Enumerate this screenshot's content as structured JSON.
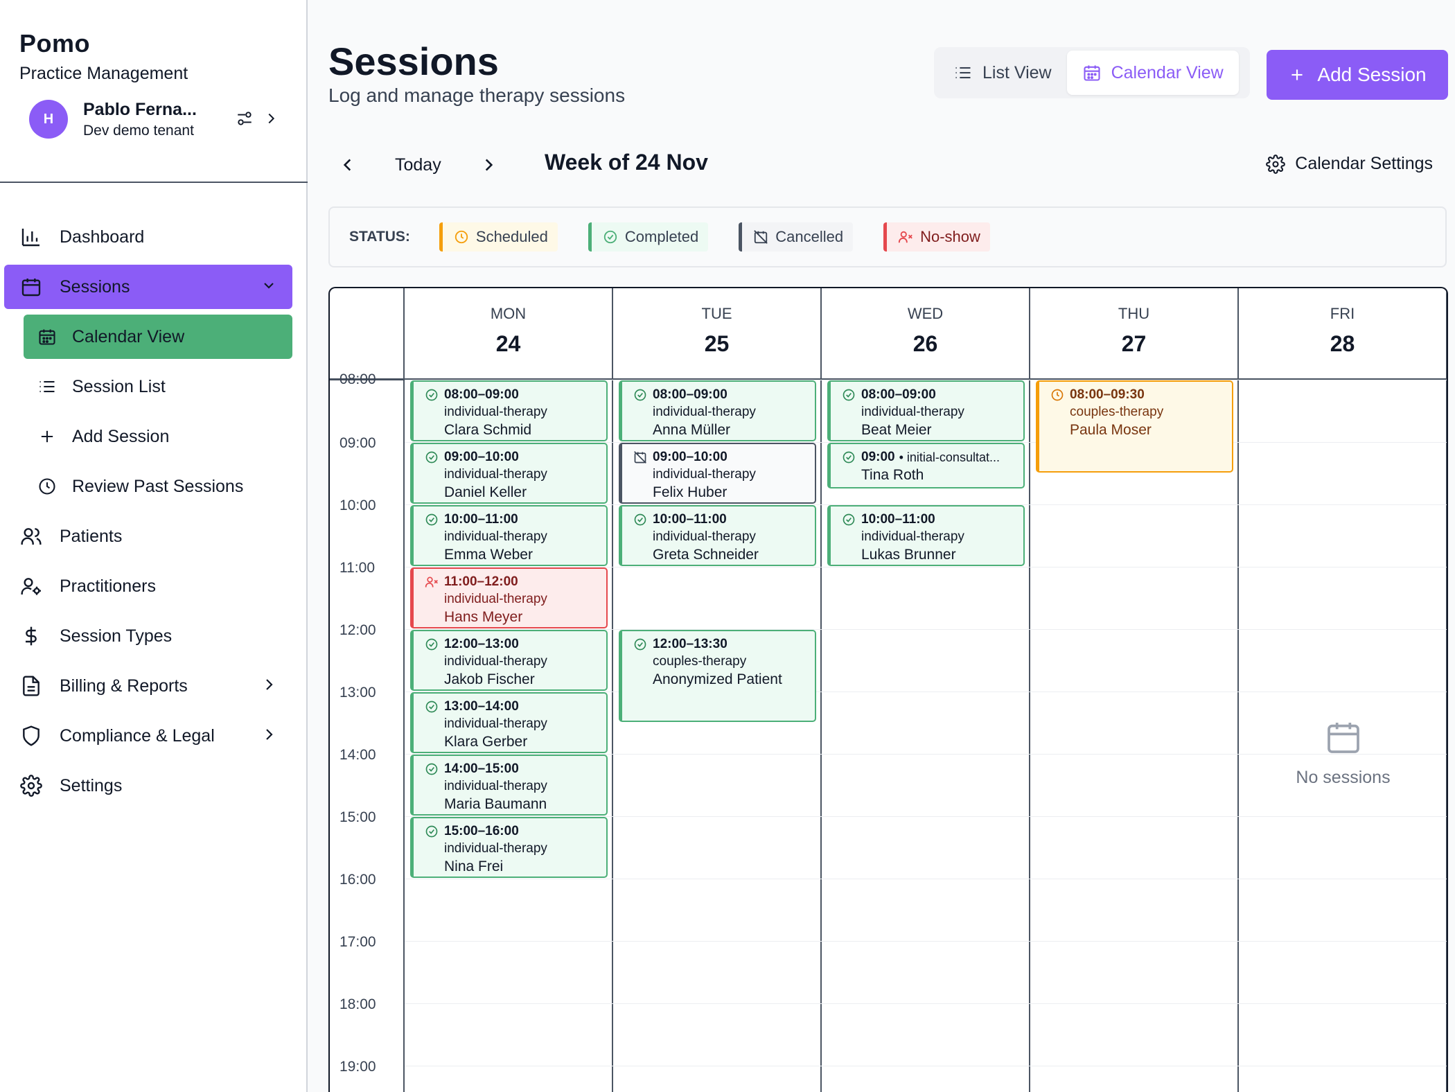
{
  "brand": {
    "name": "Pomo",
    "subtitle": "Practice Management"
  },
  "user": {
    "initial": "H",
    "name": "Pablo Ferna...",
    "tenant": "Dev demo tenant"
  },
  "nav": {
    "dashboard": "Dashboard",
    "sessions": "Sessions",
    "calendar_view": "Calendar View",
    "session_list": "Session List",
    "add_session": "Add Session",
    "review_past": "Review Past Sessions",
    "patients": "Patients",
    "practitioners": "Practitioners",
    "session_types": "Session Types",
    "billing": "Billing & Reports",
    "compliance": "Compliance & Legal",
    "settings": "Settings"
  },
  "header": {
    "title": "Sessions",
    "subtitle": "Log and manage therapy sessions",
    "list_view": "List View",
    "calendar_view": "Calendar View",
    "add_session": "Add Session"
  },
  "week": {
    "today": "Today",
    "label": "Week of 24 Nov",
    "settings": "Calendar Settings"
  },
  "legend": {
    "label": "STATUS:",
    "scheduled": "Scheduled",
    "completed": "Completed",
    "cancelled": "Cancelled",
    "noshow": "No-show"
  },
  "colors": {
    "accent": "#8b5cf6",
    "completed": "#4caf78",
    "scheduled": "#f59e0b",
    "cancelled": "#4b5563",
    "noshow": "#e5484d"
  },
  "times": [
    "08:00",
    "09:00",
    "10:00",
    "11:00",
    "12:00",
    "13:00",
    "14:00",
    "15:00",
    "16:00",
    "17:00",
    "18:00",
    "19:00"
  ],
  "days": [
    {
      "name": "MON",
      "num": "24"
    },
    {
      "name": "TUE",
      "num": "25"
    },
    {
      "name": "WED",
      "num": "26"
    },
    {
      "name": "THU",
      "num": "27"
    },
    {
      "name": "FRI",
      "num": "28"
    }
  ],
  "events": [
    {
      "day": 0,
      "start": 8,
      "end": 9,
      "status": "completed",
      "time": "08:00–09:00",
      "type": "individual-therapy",
      "patient": "Clara Schmid"
    },
    {
      "day": 0,
      "start": 9,
      "end": 10,
      "status": "completed",
      "time": "09:00–10:00",
      "type": "individual-therapy",
      "patient": "Daniel Keller"
    },
    {
      "day": 0,
      "start": 10,
      "end": 11,
      "status": "completed",
      "time": "10:00–11:00",
      "type": "individual-therapy",
      "patient": "Emma Weber"
    },
    {
      "day": 0,
      "start": 11,
      "end": 12,
      "status": "noshow",
      "time": "11:00–12:00",
      "type": "individual-therapy",
      "patient": "Hans Meyer"
    },
    {
      "day": 0,
      "start": 12,
      "end": 13,
      "status": "completed",
      "time": "12:00–13:00",
      "type": "individual-therapy",
      "patient": "Jakob Fischer"
    },
    {
      "day": 0,
      "start": 13,
      "end": 14,
      "status": "completed",
      "time": "13:00–14:00",
      "type": "individual-therapy",
      "patient": "Klara Gerber"
    },
    {
      "day": 0,
      "start": 14,
      "end": 15,
      "status": "completed",
      "time": "14:00–15:00",
      "type": "individual-therapy",
      "patient": "Maria Baumann"
    },
    {
      "day": 0,
      "start": 15,
      "end": 16,
      "status": "completed",
      "time": "15:00–16:00",
      "type": "individual-therapy",
      "patient": "Nina Frei"
    },
    {
      "day": 1,
      "start": 8,
      "end": 9,
      "status": "completed",
      "time": "08:00–09:00",
      "type": "individual-therapy",
      "patient": "Anna Müller"
    },
    {
      "day": 1,
      "start": 9,
      "end": 10,
      "status": "cancelled",
      "time": "09:00–10:00",
      "type": "individual-therapy",
      "patient": "Felix Huber"
    },
    {
      "day": 1,
      "start": 10,
      "end": 11,
      "status": "completed",
      "time": "10:00–11:00",
      "type": "individual-therapy",
      "patient": "Greta Schneider"
    },
    {
      "day": 1,
      "start": 12,
      "end": 13.5,
      "status": "completed",
      "time": "12:00–13:30",
      "type": "couples-therapy",
      "patient": "Anonymized Patient"
    },
    {
      "day": 2,
      "start": 8,
      "end": 9,
      "status": "completed",
      "time": "08:00–09:00",
      "type": "individual-therapy",
      "patient": "Beat Meier"
    },
    {
      "day": 2,
      "start": 9,
      "end": 9.75,
      "status": "completed",
      "time": "09:00",
      "inline_type": "• initial-consultat...",
      "patient": "Tina Roth"
    },
    {
      "day": 2,
      "start": 10,
      "end": 11,
      "status": "completed",
      "time": "10:00–11:00",
      "type": "individual-therapy",
      "patient": "Lukas Brunner"
    },
    {
      "day": 3,
      "start": 8,
      "end": 9.5,
      "status": "scheduled",
      "time": "08:00–09:30",
      "type": "couples-therapy",
      "patient": "Paula Moser"
    }
  ],
  "empty": {
    "day": 4,
    "text": "No sessions"
  }
}
